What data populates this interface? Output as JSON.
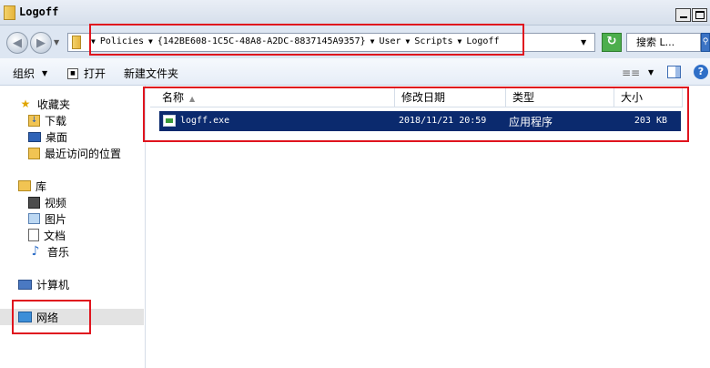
{
  "window": {
    "title": "Logoff",
    "minimize_icon": "minimize-icon",
    "maximize_icon": "maximize-icon"
  },
  "address": {
    "breadcrumbs": [
      "Policies",
      "{142BE608-1C5C-48A8-A2DC-8837145A9357}",
      "User",
      "Scripts",
      "Logoff"
    ],
    "search_placeholder": "搜索 L..."
  },
  "toolbar": {
    "organize_label": "组织",
    "open_label": "打开",
    "new_folder_label": "新建文件夹"
  },
  "nav": {
    "favorites": {
      "label": "收藏夹",
      "items": [
        "下载",
        "桌面",
        "最近访问的位置"
      ]
    },
    "libraries": {
      "label": "库",
      "items": [
        "视频",
        "图片",
        "文档",
        "音乐"
      ]
    },
    "computer_label": "计算机",
    "network_label": "网络"
  },
  "columns": {
    "name": "名称",
    "date": "修改日期",
    "type": "类型",
    "size": "大小"
  },
  "files": [
    {
      "name": "logff.exe",
      "date": "2018/11/21 20:59",
      "type": "应用程序",
      "size": "203 KB"
    }
  ],
  "colors": {
    "selection": "#0b2a6e",
    "annotation": "#e0141e"
  }
}
